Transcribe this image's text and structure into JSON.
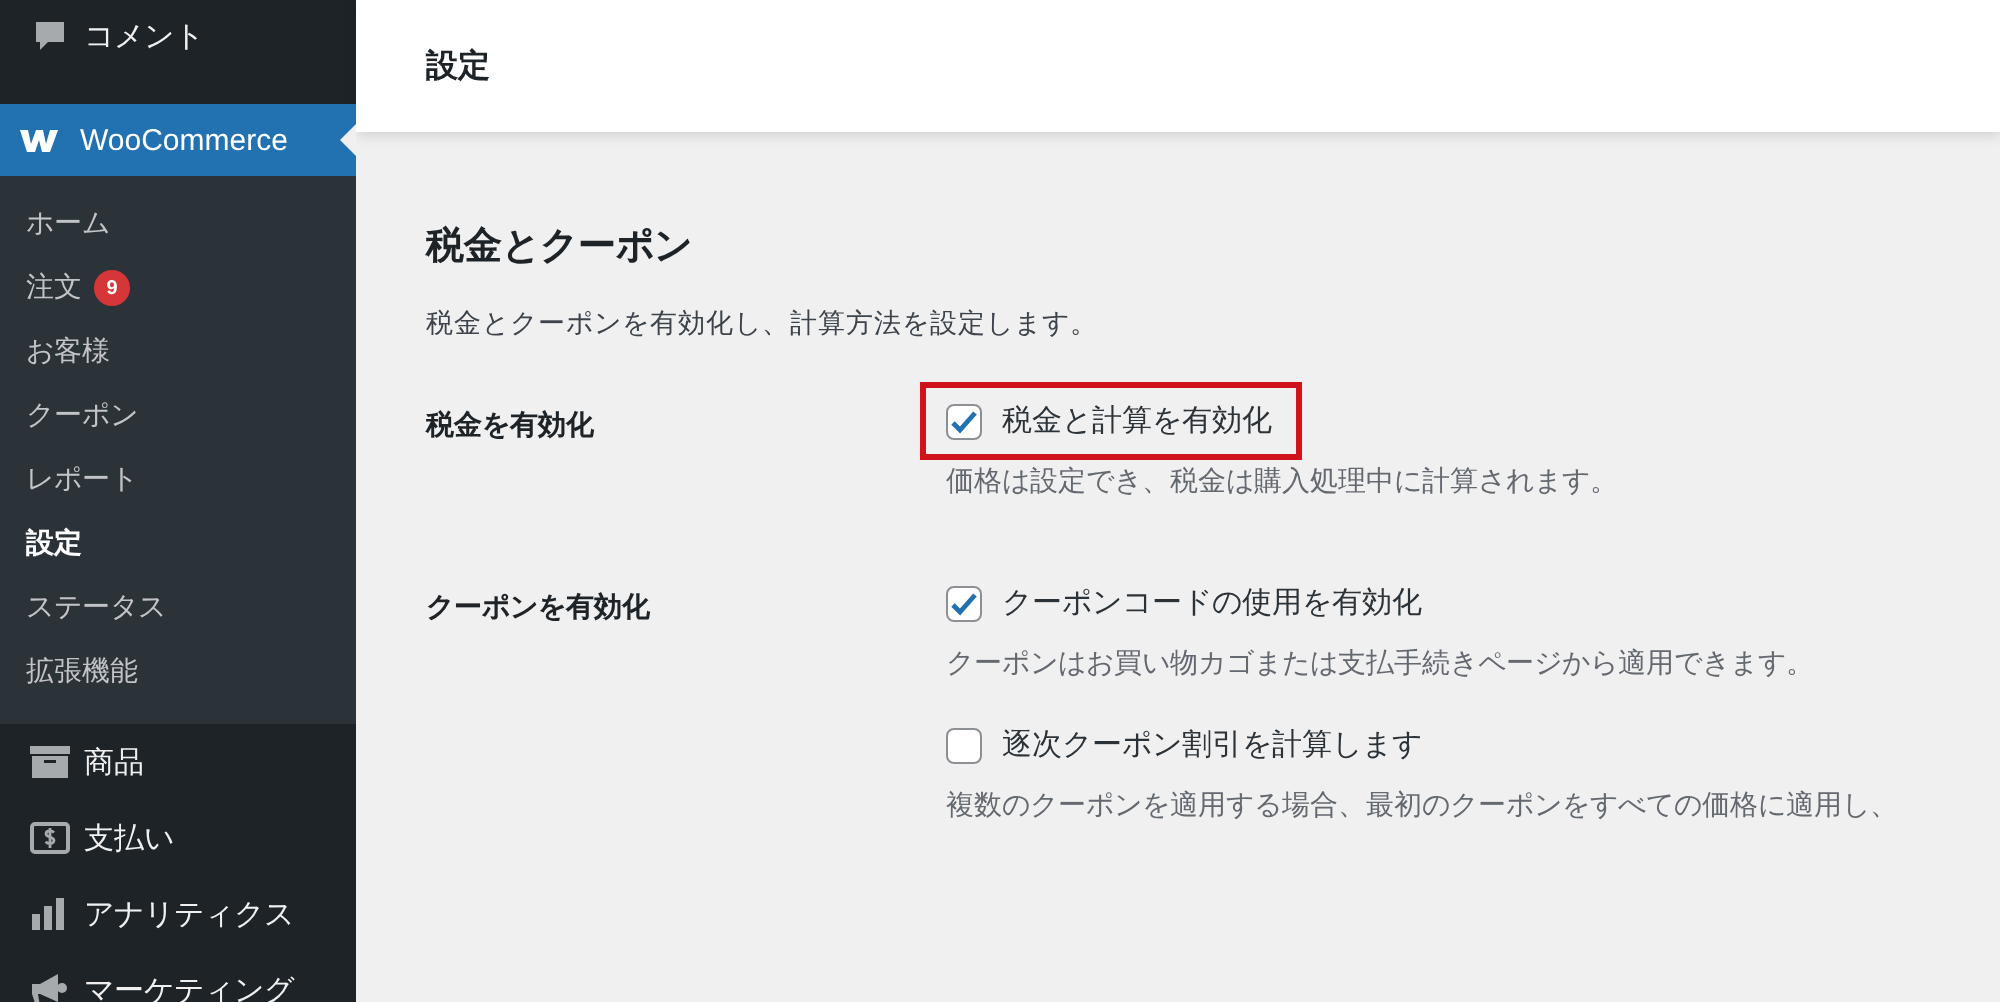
{
  "sidebar": {
    "top_items": [
      {
        "label": "コメント",
        "kind": "comment"
      }
    ],
    "active_menu": {
      "label": "WooCommerce"
    },
    "submenu": [
      {
        "label": "ホーム",
        "selected": false
      },
      {
        "label": "注文",
        "selected": false,
        "badge": "9"
      },
      {
        "label": "お客様",
        "selected": false
      },
      {
        "label": "クーポン",
        "selected": false
      },
      {
        "label": "レポート",
        "selected": false
      },
      {
        "label": "設定",
        "selected": true
      },
      {
        "label": "ステータス",
        "selected": false
      },
      {
        "label": "拡張機能",
        "selected": false
      }
    ],
    "items": [
      {
        "label": "商品",
        "kind": "archive"
      },
      {
        "label": "支払い",
        "kind": "money"
      },
      {
        "label": "アナリティクス",
        "kind": "chart"
      },
      {
        "label": "マーケティング",
        "kind": "megaphone"
      }
    ]
  },
  "header": {
    "title": "設定"
  },
  "section": {
    "title": "税金とクーポン",
    "description": "税金とクーポンを有効化し、計算方法を設定します。",
    "rows": [
      {
        "label": "税金を有効化",
        "options": [
          {
            "label": "税金と計算を有効化",
            "checked": true,
            "highlighted": true,
            "help": "価格は設定でき、税金は購入処理中に計算されます。"
          }
        ]
      },
      {
        "label": "クーポンを有効化",
        "options": [
          {
            "label": "クーポンコードの使用を有効化",
            "checked": true,
            "highlighted": false,
            "help": "クーポンはお買い物カゴまたは支払手続きページから適用できます。"
          },
          {
            "label": "逐次クーポン割引を計算します",
            "checked": false,
            "highlighted": false,
            "help": "複数のクーポンを適用する場合、最初のクーポンをすべての価格に適用し、"
          }
        ]
      }
    ]
  }
}
